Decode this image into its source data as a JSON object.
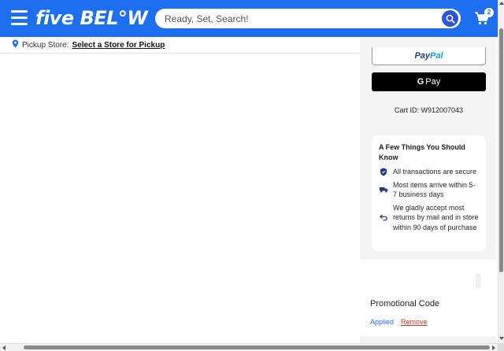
{
  "header": {
    "logo_text": "five BEL°W",
    "search": {
      "placeholder": "Ready, Set, Search!"
    },
    "cart": {
      "count": "2"
    },
    "colors": {
      "brand_blue": "#1e6ef0",
      "search_button": "#2e54d8"
    },
    "icons": {
      "menu": "hamburger-icon",
      "search": "search-icon",
      "cart": "cart-icon"
    }
  },
  "pickup": {
    "label": "Pickup Store:",
    "link": "Select a Store for Pickup",
    "icon": "location-pin-icon"
  },
  "checkout": {
    "paypal": {
      "pay": "Pay",
      "pal": "Pal"
    },
    "gpay": {
      "g": "G",
      "label": "Pay"
    },
    "cart_id": "Cart ID: W912007043"
  },
  "info_card": {
    "title": "A Few Things You Should Know",
    "items": [
      {
        "icon": "shield-icon",
        "text": "All transactions are secure"
      },
      {
        "icon": "truck-icon",
        "text": "Most items arrive within 5-7 business days"
      },
      {
        "icon": "return-arrow-icon",
        "text": "We gladly accept most returns by mail and in store within 90 days of purchase"
      }
    ]
  },
  "promo": {
    "title": "Promotional Code",
    "applied": "Applied",
    "remove": "Remove",
    "colors": {
      "applied": "#1e6ef0",
      "remove": "#c0392b"
    }
  }
}
